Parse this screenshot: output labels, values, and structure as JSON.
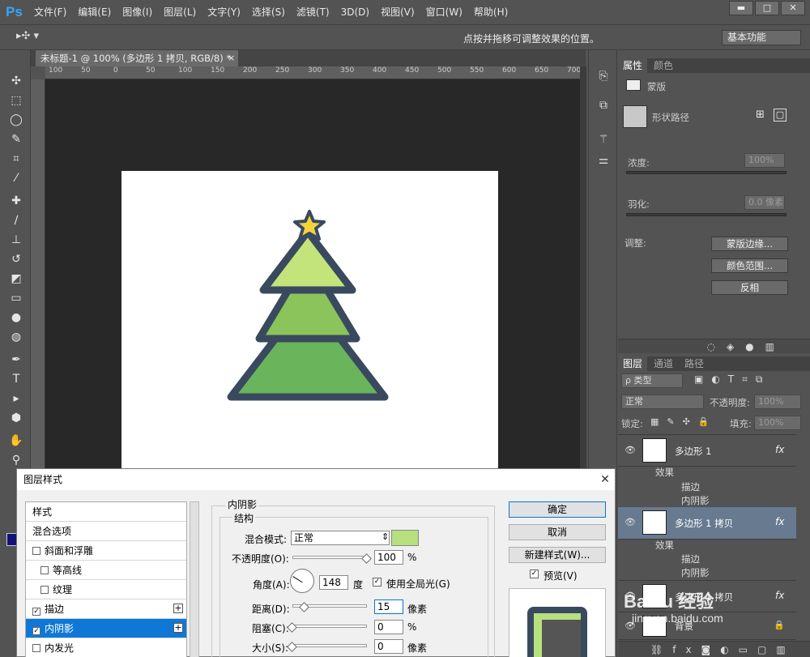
{
  "app": {
    "logo": "Ps"
  },
  "menu": [
    "文件(F)",
    "编辑(E)",
    "图像(I)",
    "图层(L)",
    "文字(Y)",
    "选择(S)",
    "滤镜(T)",
    "3D(D)",
    "视图(V)",
    "窗口(W)",
    "帮助(H)"
  ],
  "window_controls": {
    "minimize": "▬",
    "maximize": "□",
    "close": "✕"
  },
  "options_bar": {
    "tool_preset": "▸✣ ▾",
    "hint": "点按并拖移可调整效果的位置。",
    "workspace": "基本功能"
  },
  "document": {
    "tab_title": "未标题-1 @ 100% (多边形 1 拷贝, RGB/8) *",
    "tab_close": "×",
    "ruler_ticks": [
      "100",
      "50",
      "0",
      "50",
      "100",
      "150",
      "200",
      "250",
      "300",
      "350",
      "400",
      "450",
      "500",
      "550",
      "600",
      "650",
      "700"
    ],
    "colors": {
      "star": "#f5d33d",
      "tier_top": "#c3e47a",
      "tier_mid": "#8ac45a",
      "tier_bottom": "#6ab55b",
      "outline": "#3a4a5e"
    }
  },
  "properties_panel": {
    "tabs": [
      "属性",
      "颜色"
    ],
    "section": "蒙版",
    "shape_path_label": "形状路径",
    "density_label": "浓度:",
    "density_value": "100%",
    "feather_label": "羽化:",
    "feather_value": "0.0 像素",
    "adjust_label": "调整:",
    "buttons": [
      "蒙版边缘...",
      "颜色范围...",
      "反相"
    ]
  },
  "layers_panel": {
    "tabs": [
      "图层",
      "通道",
      "路径"
    ],
    "filter_kind": "ρ 类型",
    "blend_mode": "正常",
    "opacity_label": "不透明度:",
    "opacity_value": "100%",
    "lock_label": "锁定:",
    "fill_label": "填充:",
    "fill_value": "100%",
    "layers": [
      {
        "name": "多边形 1",
        "fx": "fx",
        "effects_label": "效果",
        "effects": [
          "描边",
          "内阴影"
        ]
      },
      {
        "name": "多边形 1 拷贝",
        "fx": "fx",
        "effects_label": "效果",
        "effects": [
          "描边",
          "内阴影"
        ]
      },
      {
        "name": "多边形 1 拷贝",
        "fx": "fx"
      },
      {
        "name": "背景"
      }
    ]
  },
  "dialog": {
    "title": "图层样式",
    "close": "✕",
    "styles": [
      {
        "label": "样式",
        "checkbox": false,
        "checked": false
      },
      {
        "label": "混合选项",
        "checkbox": false,
        "checked": false
      },
      {
        "label": "斜面和浮雕",
        "checkbox": true,
        "checked": false
      },
      {
        "label": "等高线",
        "checkbox": true,
        "checked": false,
        "indent": true
      },
      {
        "label": "纹理",
        "checkbox": true,
        "checked": false,
        "indent": true
      },
      {
        "label": "描边",
        "checkbox": true,
        "checked": true,
        "plus": true
      },
      {
        "label": "内阴影",
        "checkbox": true,
        "checked": true,
        "plus": true,
        "selected": true
      },
      {
        "label": "内发光",
        "checkbox": true,
        "checked": false
      }
    ],
    "section_title": "内阴影",
    "group_title": "结构",
    "blend_mode_label": "混合模式:",
    "blend_mode_value": "正常",
    "blend_color": "#b7e07f",
    "opacity_label": "不透明度(O):",
    "opacity_value": "100",
    "opacity_unit": "%",
    "angle_label": "角度(A):",
    "angle_value": "148",
    "angle_unit": "度",
    "global_light_label": "使用全局光(G)",
    "global_light_checked": true,
    "distance_label": "距离(D):",
    "distance_value": "15",
    "distance_unit": "像素",
    "choke_label": "阻塞(C):",
    "choke_value": "0",
    "choke_unit": "%",
    "size_label": "大小(S):",
    "size_value": "0",
    "size_unit": "像素",
    "buttons": {
      "ok": "确定",
      "cancel": "取消",
      "new_style": "新建样式(W)...",
      "preview": "预览(V)"
    },
    "preview_checked": true
  },
  "watermark": {
    "brand": "Baidu 经验",
    "url": "jingyan.baidu.com"
  }
}
